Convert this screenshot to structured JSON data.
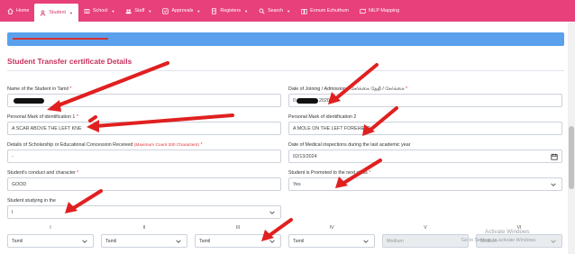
{
  "nav": {
    "items": [
      {
        "label": "Home",
        "icon": "home-icon",
        "caret": false
      },
      {
        "label": "Student",
        "icon": "user-icon",
        "caret": true,
        "active": true
      },
      {
        "label": "School",
        "icon": "school-icon",
        "caret": true
      },
      {
        "label": "Staff",
        "icon": "staff-icon",
        "caret": true
      },
      {
        "label": "Approvals",
        "icon": "approvals-icon",
        "caret": true
      },
      {
        "label": "Registers",
        "icon": "registers-icon",
        "caret": true
      },
      {
        "label": "Search",
        "icon": "search-icon",
        "caret": true
      },
      {
        "label": "Ennum Ezhuthum",
        "icon": "book-icon",
        "caret": false
      },
      {
        "label": "NILP Mapping",
        "icon": "map-icon",
        "caret": false
      }
    ]
  },
  "page": {
    "section_title": "Student Transfer certificate Details"
  },
  "form": {
    "name_label": "Name of the Student in Tamil ",
    "doj_label": "Date of Joining / Admission - சேர்க்கை தேதி / சேர்க்கை ",
    "doj_value_prefix": "0",
    "doj_value_suffix": "2020",
    "mark1_label": "Personal Mark of identification 1 ",
    "mark1_value": "A SCAR ABOVE THE LEFT KNE",
    "mark2_label": "Personal Mark of identification 2",
    "mark2_value": "A MOLE ON THE LEFT FOREHEAD",
    "scholarship_label": "Details of Scholarship or Educational Concession Received ",
    "scholarship_hint": "(Maximum Count 200 Characters)",
    "scholarship_value": "-",
    "medical_label": "Date of Medical inspections during the last academic year",
    "medical_value": "02/13/2024",
    "conduct_label": "Student's conduct and character ",
    "conduct_value": "GOOD",
    "promoted_label": "Student is Promoted to the next class ",
    "promoted_value": "Yes",
    "studying_label": "Student studying in the ",
    "studying_value": "I",
    "required_mark": "*"
  },
  "grades": {
    "headers": [
      "I",
      "II",
      "III",
      "IV",
      "V",
      "VI"
    ],
    "values": [
      "Tamil",
      "Tamil",
      "Tamil",
      "Tamil",
      "Medium",
      "Medium"
    ]
  },
  "watermark": {
    "line1": "Activate Windows",
    "line2": "Go to Settings to activate Windows."
  },
  "colors": {
    "nav": "#e8407a",
    "title": "#c8305c",
    "banner": "#5aa0ec",
    "arrow": "#e02020"
  }
}
